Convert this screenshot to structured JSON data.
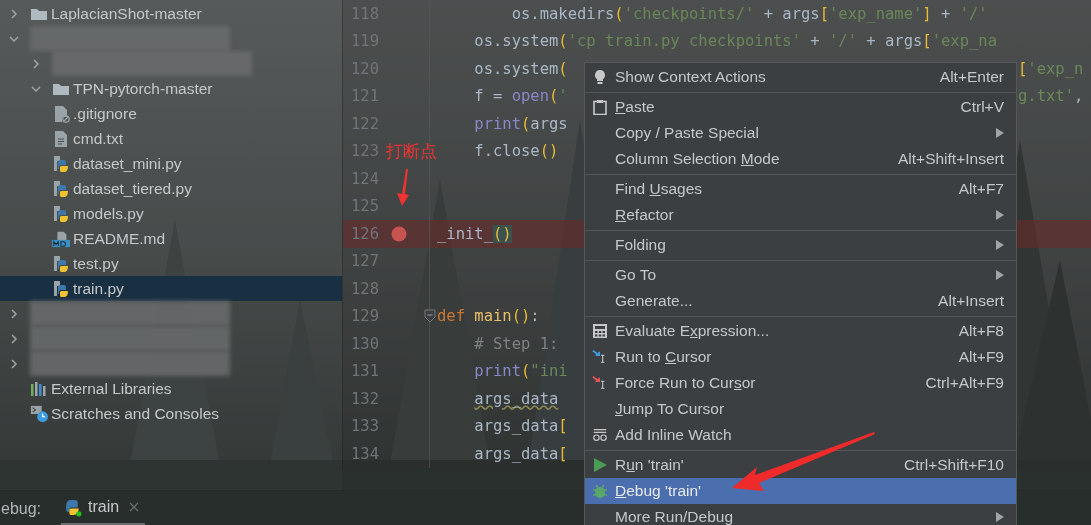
{
  "project_tree": [
    {
      "kind": "folder",
      "label": "LaplacianShot-master",
      "expanded": false,
      "selected": false
    },
    {
      "kind": "redacted",
      "expanded": true,
      "selected": false,
      "children": [
        {
          "kind": "redacted",
          "expanded": false,
          "selected": false
        },
        {
          "kind": "folder",
          "label": "TPN-pytorch-master",
          "expanded": true,
          "selected": false,
          "children": [
            {
              "kind": "gitignore",
              "label": ".gitignore",
              "selected": false
            },
            {
              "kind": "text",
              "label": "cmd.txt",
              "selected": false
            },
            {
              "kind": "python",
              "label": "dataset_mini.py",
              "selected": false
            },
            {
              "kind": "python",
              "label": "dataset_tiered.py",
              "selected": false
            },
            {
              "kind": "python",
              "label": "models.py",
              "selected": false
            },
            {
              "kind": "markdown",
              "label": "README.md",
              "selected": false
            },
            {
              "kind": "python",
              "label": "test.py",
              "selected": false
            },
            {
              "kind": "python",
              "label": "train.py",
              "selected": true
            }
          ]
        }
      ]
    },
    {
      "kind": "redacted",
      "expanded": false,
      "selected": false
    },
    {
      "kind": "redacted",
      "expanded": false,
      "selected": false
    },
    {
      "kind": "redacted",
      "expanded": false,
      "selected": false
    },
    {
      "kind": "libraries",
      "label": "External Libraries",
      "selected": false
    },
    {
      "kind": "scratches",
      "label": "Scratches and Consoles",
      "selected": false
    }
  ],
  "editor": {
    "lines": [
      {
        "number": "118",
        "breakpoint": false,
        "tokens": [
          {
            "kind": "plain",
            "text": "        os.makedirs"
          },
          {
            "kind": "paren",
            "text": "("
          },
          {
            "kind": "string",
            "text": "'checkpoints/'"
          },
          {
            "kind": "plain",
            "text": " + args"
          },
          {
            "kind": "paren",
            "text": "["
          },
          {
            "kind": "string",
            "text": "'exp_name'"
          },
          {
            "kind": "paren",
            "text": "]"
          },
          {
            "kind": "plain",
            "text": " + "
          },
          {
            "kind": "string",
            "text": "'/'"
          }
        ]
      },
      {
        "number": "119",
        "breakpoint": false,
        "tokens": [
          {
            "kind": "plain",
            "text": "    os.system"
          },
          {
            "kind": "paren",
            "text": "("
          },
          {
            "kind": "string",
            "text": "'cp train.py checkpoints'"
          },
          {
            "kind": "plain",
            "text": " + "
          },
          {
            "kind": "string",
            "text": "'/'"
          },
          {
            "kind": "plain",
            "text": " + args"
          },
          {
            "kind": "paren",
            "text": "["
          },
          {
            "kind": "string",
            "text": "'exp_na"
          }
        ]
      },
      {
        "number": "120",
        "breakpoint": false,
        "tokens": [
          {
            "kind": "plain",
            "text": "    os.system"
          },
          {
            "kind": "paren",
            "text": "("
          }
        ],
        "tail": [
          {
            "kind": "paren",
            "text": "["
          },
          {
            "kind": "string",
            "text": "'exp_n"
          }
        ]
      },
      {
        "number": "121",
        "breakpoint": false,
        "tokens": [
          {
            "kind": "plain",
            "text": "    f = "
          },
          {
            "kind": "builtin",
            "text": "open"
          },
          {
            "kind": "paren",
            "text": "("
          },
          {
            "kind": "string",
            "text": "'"
          }
        ],
        "tail": [
          {
            "kind": "string",
            "text": "g.txt'"
          },
          {
            "kind": "plain",
            "text": ","
          }
        ]
      },
      {
        "number": "122",
        "breakpoint": false,
        "tokens": [
          {
            "kind": "builtin",
            "text": "    print"
          },
          {
            "kind": "paren",
            "text": "("
          },
          {
            "kind": "plain",
            "text": "args"
          }
        ]
      },
      {
        "number": "123",
        "breakpoint": false,
        "tokens": [
          {
            "kind": "plain",
            "text": "    f.close"
          },
          {
            "kind": "paren",
            "text": "()"
          }
        ]
      },
      {
        "number": "124",
        "breakpoint": false
      },
      {
        "number": "125",
        "breakpoint": false
      },
      {
        "number": "126",
        "breakpoint": true,
        "tokens": [
          {
            "kind": "plain",
            "text": "_init_"
          },
          {
            "kind": "matched",
            "text": "()"
          }
        ]
      },
      {
        "number": "127",
        "breakpoint": false
      },
      {
        "number": "128",
        "breakpoint": false
      },
      {
        "number": "129",
        "breakpoint": false,
        "fold": true,
        "tokens": [
          {
            "kind": "keyword",
            "text": "def "
          },
          {
            "kind": "function",
            "text": "main"
          },
          {
            "kind": "paren",
            "text": "()"
          },
          {
            "kind": "plain",
            "text": ":"
          }
        ]
      },
      {
        "number": "130",
        "breakpoint": false,
        "tokens": [
          {
            "kind": "comment",
            "text": "    # Step 1:"
          }
        ]
      },
      {
        "number": "131",
        "breakpoint": false,
        "tokens": [
          {
            "kind": "builtin",
            "text": "    print"
          },
          {
            "kind": "paren",
            "text": "("
          },
          {
            "kind": "string",
            "text": "\"ini"
          }
        ]
      },
      {
        "number": "132",
        "breakpoint": false,
        "tokens": [
          {
            "kind": "warning",
            "text": "    args_data"
          }
        ]
      },
      {
        "number": "133",
        "breakpoint": false,
        "tokens": [
          {
            "kind": "plain",
            "text": "    args_data"
          },
          {
            "kind": "paren",
            "text": "["
          }
        ]
      },
      {
        "number": "134",
        "breakpoint": false,
        "tokens": [
          {
            "kind": "plain",
            "text": "    args_data"
          },
          {
            "kind": "paren",
            "text": "["
          }
        ]
      }
    ]
  },
  "annotation": {
    "label": "打断点"
  },
  "context_menu": [
    {
      "kind": "item",
      "label": "Show Context Actions",
      "shortcut": "Alt+Enter",
      "submenu": false,
      "selected": false
    },
    {
      "kind": "separator"
    },
    {
      "kind": "item",
      "label": "Paste",
      "shortcut": "Ctrl+V",
      "submenu": false,
      "selected": false
    },
    {
      "kind": "item",
      "label": "Copy / Paste Special",
      "submenu": true,
      "selected": false
    },
    {
      "kind": "item",
      "label": "Column Selection Mode",
      "shortcut": "Alt+Shift+Insert",
      "submenu": false,
      "selected": false
    },
    {
      "kind": "separator"
    },
    {
      "kind": "item",
      "label": "Find Usages",
      "shortcut": "Alt+F7",
      "submenu": false,
      "selected": false
    },
    {
      "kind": "item",
      "label": "Refactor",
      "submenu": true,
      "selected": false
    },
    {
      "kind": "separator"
    },
    {
      "kind": "item",
      "label": "Folding",
      "submenu": true,
      "selected": false
    },
    {
      "kind": "separator"
    },
    {
      "kind": "item",
      "label": "Go To",
      "submenu": true,
      "selected": false
    },
    {
      "kind": "item",
      "label": "Generate...",
      "shortcut": "Alt+Insert",
      "submenu": false,
      "selected": false
    },
    {
      "kind": "separator"
    },
    {
      "kind": "item",
      "label": "Evaluate Expression...",
      "shortcut": "Alt+F8",
      "submenu": false,
      "selected": false
    },
    {
      "kind": "item",
      "label": "Run to Cursor",
      "shortcut": "Alt+F9",
      "submenu": false,
      "selected": false
    },
    {
      "kind": "item",
      "label": "Force Run to Cursor",
      "shortcut": "Ctrl+Alt+F9",
      "submenu": false,
      "selected": false
    },
    {
      "kind": "item",
      "label": "Jump To Cursor",
      "submenu": false,
      "selected": false
    },
    {
      "kind": "item",
      "label": "Add Inline Watch",
      "submenu": false,
      "selected": false
    },
    {
      "kind": "separator"
    },
    {
      "kind": "item",
      "label": "Run 'train'",
      "shortcut": "Ctrl+Shift+F10",
      "submenu": false,
      "selected": false
    },
    {
      "kind": "item",
      "label": "Debug 'train'",
      "submenu": false,
      "selected": true
    },
    {
      "kind": "item",
      "label": "More Run/Debug",
      "submenu": true,
      "selected": false
    }
  ],
  "debug_bar": {
    "label": "ebug:",
    "tabs": [
      {
        "label": "train",
        "selected": true
      }
    ]
  }
}
